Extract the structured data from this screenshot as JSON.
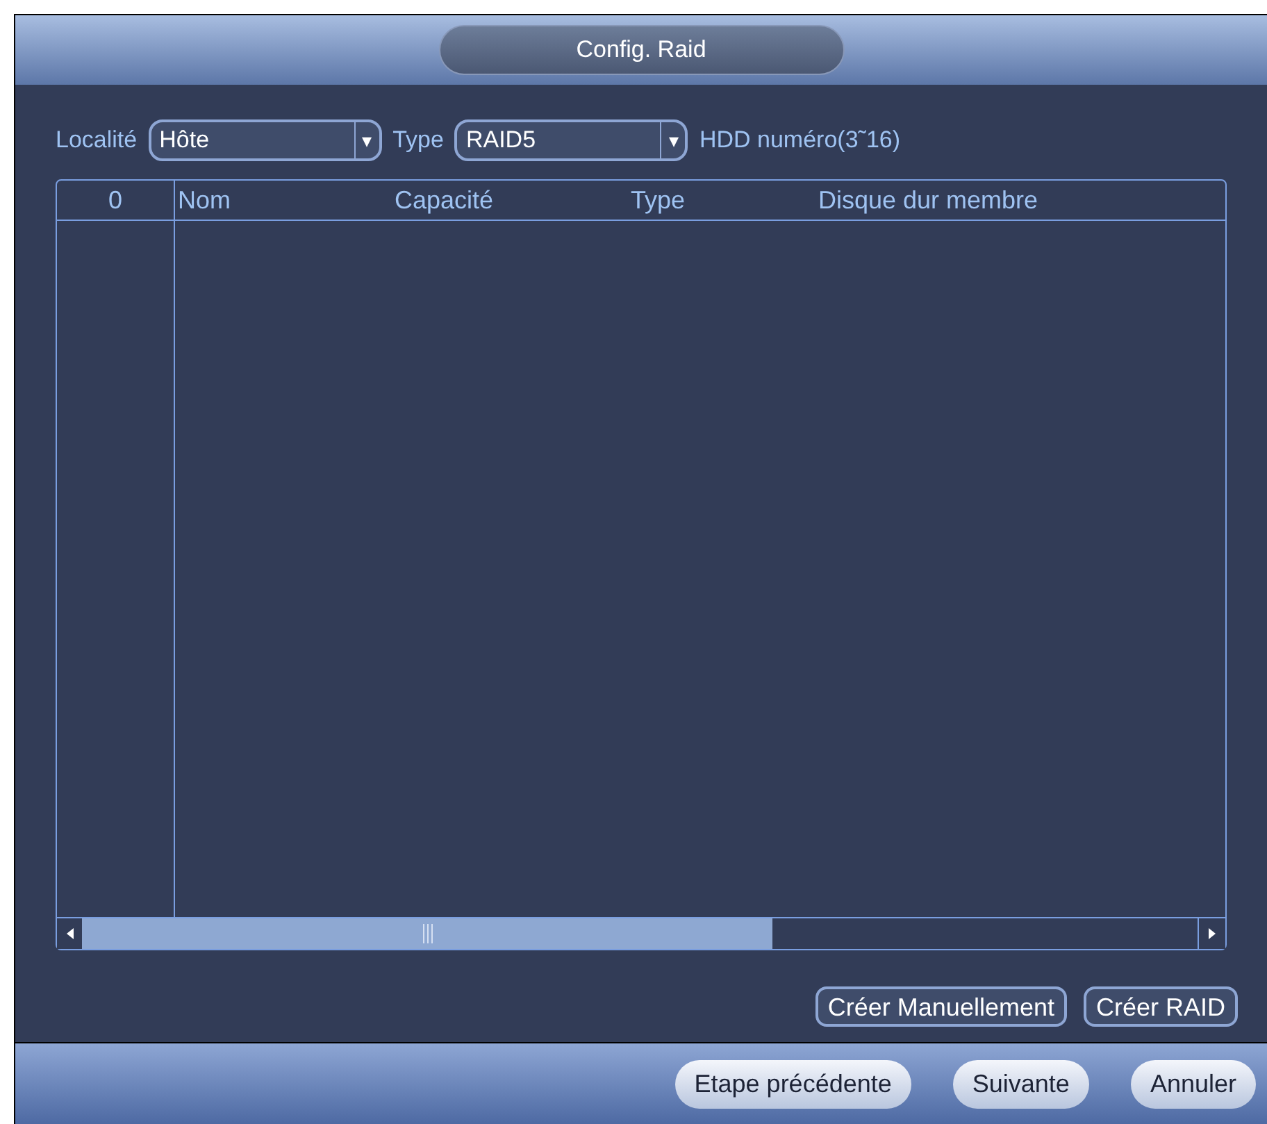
{
  "window": {
    "title": "Config. Raid"
  },
  "filters": [
    {
      "label": "Localité",
      "value": "Hôte",
      "arrow": "▾"
    },
    {
      "label": "Type",
      "value": "RAID5",
      "arrow": "▾"
    }
  ],
  "hint": "HDD numéro(3˜16)",
  "table": {
    "columns": [
      "0",
      "Nom",
      "Capacité",
      "Type",
      "Disque dur membre"
    ]
  },
  "actions": [
    "Créer Manuellement",
    "Créer RAID"
  ],
  "footer_buttons": [
    "Etape précédente",
    "Suivante",
    "Annuler"
  ]
}
